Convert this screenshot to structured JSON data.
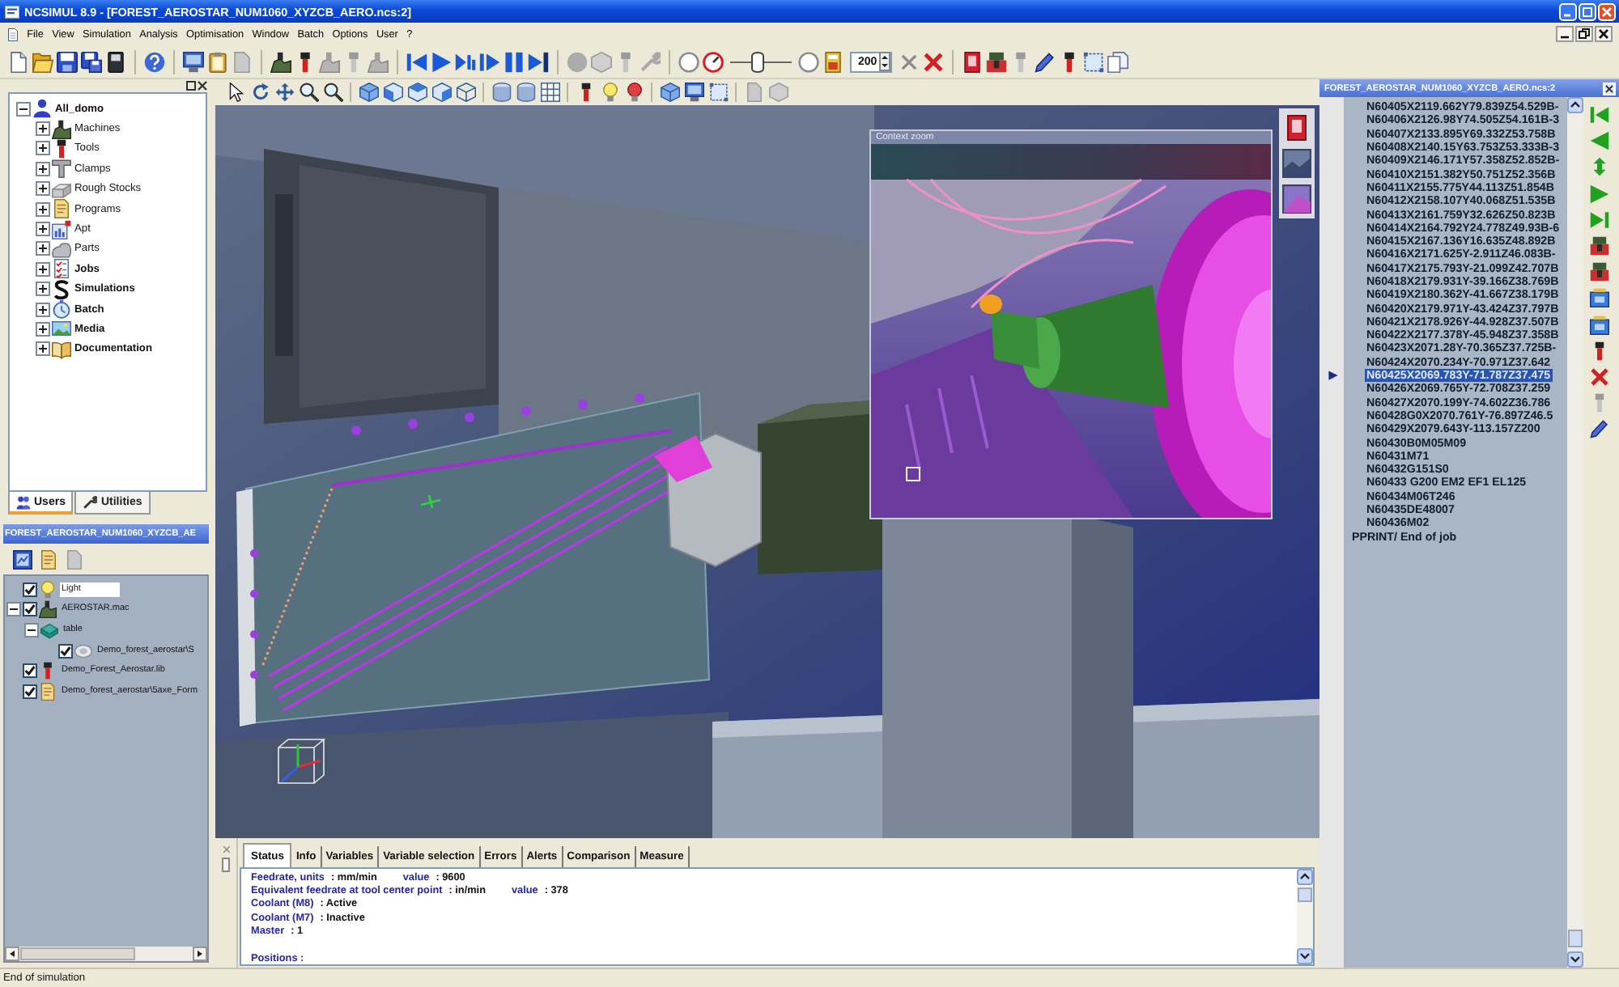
{
  "window": {
    "title": "NCSIMUL 8.9 - [FOREST_AEROSTAR_NUM1060_XYZCB_AERO.ncs:2]"
  },
  "menu": [
    "File",
    "View",
    "Simulation",
    "Analysis",
    "Optimisation",
    "Window",
    "Batch",
    "Options",
    "User",
    "?"
  ],
  "toolbar": {
    "speed_slider": {
      "level": 0.46
    },
    "zoom_field": {
      "value": "200"
    }
  },
  "project_tree": {
    "items": [
      {
        "label": "All_domo",
        "kind": "user",
        "bold": true,
        "expanded": true,
        "children": [
          {
            "label": "Machines",
            "kind": "machine",
            "bold": false,
            "expanded": false
          },
          {
            "label": "Tools",
            "kind": "tool",
            "bold": false,
            "expanded": false
          },
          {
            "label": "Clamps",
            "kind": "clamp",
            "bold": false,
            "expanded": false
          },
          {
            "label": "Rough Stocks",
            "kind": "stock",
            "bold": false,
            "expanded": false
          },
          {
            "label": "Programs",
            "kind": "program",
            "bold": false,
            "expanded": false
          },
          {
            "label": "Apt",
            "kind": "apt",
            "bold": false,
            "expanded": false
          },
          {
            "label": "Parts",
            "kind": "part",
            "bold": false,
            "expanded": false
          },
          {
            "label": "Jobs",
            "kind": "job",
            "bold": true,
            "expanded": false
          },
          {
            "label": "Simulations",
            "kind": "simulation",
            "bold": true,
            "expanded": false
          },
          {
            "label": "Batch",
            "kind": "batch",
            "bold": true,
            "expanded": false
          },
          {
            "label": "Media",
            "kind": "media",
            "bold": true,
            "expanded": false
          },
          {
            "label": "Documentation",
            "kind": "documentation",
            "bold": true,
            "expanded": false
          }
        ]
      }
    ]
  },
  "left_tabs": [
    {
      "label": "Users",
      "kind": "users",
      "selected": true
    },
    {
      "label": "Utilities",
      "kind": "utilities",
      "selected": false
    }
  ],
  "scene_tree": {
    "title": "FOREST_AEROSTAR_NUM1060_XYZCB_AE",
    "items": [
      {
        "label": "Light",
        "kind": "light",
        "checked": true,
        "selected": true
      },
      {
        "label": "AEROSTAR.mac",
        "kind": "machine",
        "checked": true,
        "selected": false,
        "expanded": true,
        "children": [
          {
            "label": "table",
            "kind": "table",
            "selected": false,
            "expanded": true,
            "children": [
              {
                "label": "Demo_forest_aerostar\\S",
                "kind": "part",
                "checked": true,
                "selected": false
              }
            ]
          }
        ]
      },
      {
        "label": "Demo_Forest_Aerostar.lib",
        "kind": "tool",
        "checked": true,
        "selected": false
      },
      {
        "label": "Demo_forest_aerostar\\5axe_Form",
        "kind": "program",
        "checked": true,
        "selected": false
      }
    ]
  },
  "viewport": {
    "inset": {
      "title": "Context zoom"
    }
  },
  "program": {
    "title": "FOREST_AEROSTAR_NUM1060_XYZCB_AERO.ncs:2",
    "lines": [
      {
        "kind": "block",
        "text": "N60405X2119.662Y79.839Z54.529B-",
        "selected": false
      },
      {
        "kind": "block",
        "text": "N60406X2126.98Y74.505Z54.161B-3",
        "selected": false
      },
      {
        "kind": "block",
        "text": "N60407X2133.895Y69.332Z53.758B",
        "selected": false
      },
      {
        "kind": "block",
        "text": "N60408X2140.15Y63.753Z53.333B-3",
        "selected": false
      },
      {
        "kind": "block",
        "text": "N60409X2146.171Y57.358Z52.852B-",
        "selected": false
      },
      {
        "kind": "block",
        "text": "N60410X2151.382Y50.751Z52.356B",
        "selected": false
      },
      {
        "kind": "block",
        "text": "N60411X2155.775Y44.113Z51.854B",
        "selected": false
      },
      {
        "kind": "block",
        "text": "N60412X2158.107Y40.068Z51.535B",
        "selected": false
      },
      {
        "kind": "block",
        "text": "N60413X2161.759Y32.626Z50.823B",
        "selected": false
      },
      {
        "kind": "block",
        "text": "N60414X2164.792Y24.778Z49.93B-6",
        "selected": false
      },
      {
        "kind": "block",
        "text": "N60415X2167.136Y16.635Z48.892B",
        "selected": false
      },
      {
        "kind": "block",
        "text": "N60416X2171.625Y-2.911Z46.083B-",
        "selected": false
      },
      {
        "kind": "block",
        "text": "N60417X2175.793Y-21.099Z42.707B",
        "selected": false
      },
      {
        "kind": "block",
        "text": "N60418X2179.931Y-39.166Z38.769B",
        "selected": false
      },
      {
        "kind": "block",
        "text": "N60419X2180.362Y-41.667Z38.179B",
        "selected": false
      },
      {
        "kind": "block",
        "text": "N60420X2179.971Y-43.424Z37.797B",
        "selected": false
      },
      {
        "kind": "block",
        "text": "N60421X2178.926Y-44.928Z37.507B",
        "selected": false
      },
      {
        "kind": "block",
        "text": "N60422X2177.378Y-45.948Z37.358B",
        "selected": false
      },
      {
        "kind": "block",
        "text": "N60423X2071.28Y-70.365Z37.725B-",
        "selected": false
      },
      {
        "kind": "block",
        "text": "N60424X2070.234Y-70.971Z37.642",
        "selected": false
      },
      {
        "kind": "block",
        "text": "N60425X2069.783Y-71.787Z37.475",
        "selected": true
      },
      {
        "kind": "block",
        "text": "N60426X2069.765Y-72.708Z37.259",
        "selected": false
      },
      {
        "kind": "block",
        "text": "N60427X2070.199Y-74.602Z36.786",
        "selected": false
      },
      {
        "kind": "block",
        "text": "N60428G0X2070.761Y-76.897Z46.5",
        "selected": false
      },
      {
        "kind": "block",
        "text": "N60429X2079.643Y-113.157Z200",
        "selected": false
      },
      {
        "kind": "block",
        "text": "N60430B0M05M09",
        "selected": false
      },
      {
        "kind": "block",
        "text": "N60431M71",
        "selected": false
      },
      {
        "kind": "block",
        "text": "N60432G151S0",
        "selected": false
      },
      {
        "kind": "block",
        "text": "N60433 G200 EM2 EF1 EL125",
        "selected": false
      },
      {
        "kind": "block",
        "text": "N60434M06T246",
        "selected": false
      },
      {
        "kind": "block",
        "text": "N60435DE48007",
        "selected": false
      },
      {
        "kind": "block",
        "text": "N60436M02",
        "selected": false
      },
      {
        "kind": "comment",
        "text": "PPRINT/ End of job",
        "selected": false
      }
    ]
  },
  "status_panel": {
    "tabs": [
      {
        "label": "Status",
        "selected": true
      },
      {
        "label": "Info",
        "selected": false
      },
      {
        "label": "Variables",
        "selected": false
      },
      {
        "label": "Variable selection",
        "selected": false
      },
      {
        "label": "Errors",
        "selected": false
      },
      {
        "label": "Alerts",
        "selected": false
      },
      {
        "label": "Comparison",
        "selected": false
      },
      {
        "label": "Measure",
        "selected": false
      }
    ],
    "lines": [
      {
        "kind": "field",
        "segments": [
          {
            "kind": "label",
            "text": "Feedrate, units"
          },
          {
            "kind": "value",
            "text": ": mm/min"
          },
          {
            "kind": "label",
            "text": "value"
          },
          {
            "kind": "value",
            "text": ": 9600"
          }
        ]
      },
      {
        "kind": "field",
        "segments": [
          {
            "kind": "label",
            "text": "Equivalent feedrate at tool center point"
          },
          {
            "kind": "value",
            "text": ": in/min"
          },
          {
            "kind": "label",
            "text": "value"
          },
          {
            "kind": "value",
            "text": ": 378"
          }
        ]
      },
      {
        "kind": "field",
        "segments": [
          {
            "kind": "label",
            "text": "Coolant (M8)"
          },
          {
            "kind": "value",
            "text": ": Active"
          }
        ]
      },
      {
        "kind": "field",
        "segments": [
          {
            "kind": "label",
            "text": "Coolant (M7)"
          },
          {
            "kind": "value",
            "text": ": Inactive"
          }
        ]
      },
      {
        "kind": "field",
        "segments": [
          {
            "kind": "label",
            "text": "Master"
          },
          {
            "kind": "value",
            "text": ": 1"
          }
        ]
      },
      {
        "kind": "section",
        "segments": [
          {
            "kind": "label",
            "text": "Positions :"
          }
        ]
      }
    ]
  },
  "status_bar": {
    "text": "End of simulation"
  }
}
